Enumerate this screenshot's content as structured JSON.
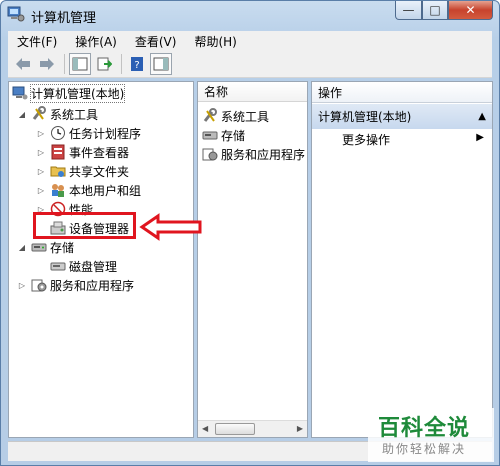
{
  "window": {
    "title": "计算机管理"
  },
  "menu": [
    "文件(F)",
    "操作(A)",
    "查看(V)",
    "帮助(H)"
  ],
  "tree": {
    "root": "计算机管理(本地)",
    "system_tools": "系统工具",
    "task_scheduler": "任务计划程序",
    "event_viewer": "事件查看器",
    "shared_folders": "共享文件夹",
    "local_users": "本地用户和组",
    "performance": "性能",
    "device_manager": "设备管理器",
    "storage": "存储",
    "disk_management": "磁盘管理",
    "services_apps": "服务和应用程序"
  },
  "list": {
    "header": "名称",
    "items": [
      "系统工具",
      "存储",
      "服务和应用程序"
    ]
  },
  "actions": {
    "header": "操作",
    "group": "计算机管理(本地)",
    "more": "更多操作"
  },
  "watermark": {
    "line1": "百科全说",
    "line2": "助你轻松解决"
  },
  "colors": {
    "annotation": "#e0151f",
    "watermark_green": "#1e8a3a"
  }
}
